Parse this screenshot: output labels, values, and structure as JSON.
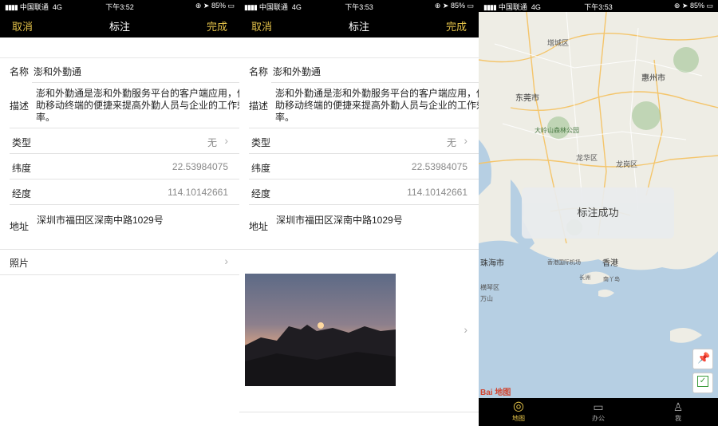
{
  "panels": [
    {
      "status": {
        "carrier": "中国联通",
        "network": "4G",
        "time": "下午3:52",
        "battery": "85%"
      },
      "nav": {
        "cancel": "取消",
        "title": "标注",
        "done": "完成"
      },
      "form": {
        "name_label": "名称",
        "name_value": "澎和外勤通",
        "desc_label": "描述",
        "desc_lines": [
          "澎和外勤通是澎和外勤服务平台的客户端应用，借",
          "助移动终端的便捷来提高外勤人员与企业的工作效",
          "率。"
        ],
        "type_label": "类型",
        "type_value": "无",
        "lat_label": "纬度",
        "lat_value": "22.53984075",
        "lng_label": "经度",
        "lng_value": "114.10142661",
        "addr_label": "地址",
        "addr_value": "深圳市福田区深南中路1029号",
        "photo_label": "照片"
      }
    },
    {
      "status": {
        "carrier": "中国联通",
        "network": "4G",
        "time": "下午3:53",
        "battery": "85%"
      },
      "nav": {
        "cancel": "取消",
        "title": "标注",
        "done": "完成"
      },
      "form": {
        "name_label": "名称",
        "name_value": "澎和外勤通",
        "desc_label": "描述",
        "desc_lines": [
          "澎和外勤通是澎和外勤服务平台的客户端应用，借",
          "助移动终端的便捷来提高外勤人员与企业的工作效",
          "率。"
        ],
        "type_label": "类型",
        "type_value": "无",
        "lat_label": "纬度",
        "lat_value": "22.53984075",
        "lng_label": "经度",
        "lng_value": "114.10142661",
        "addr_label": "地址",
        "addr_value": "深圳市福田区深南中路1029号"
      }
    },
    {
      "status": {
        "carrier": "中国联通",
        "network": "4G",
        "time": "下午3:53",
        "battery": "85%"
      },
      "map_labels": [
        "增城区",
        "惠州市",
        "东莞市",
        "大岭山森林公园",
        "龙华区",
        "龙岗区",
        "珠海市",
        "香港国际机场",
        "香港",
        "长洲",
        "南丫岛",
        "横琴区",
        "万山"
      ],
      "toast": "标注成功",
      "map_logo": "Bai 地图",
      "tabs": [
        "地图",
        "办公",
        "我"
      ]
    }
  ],
  "colors": {
    "accent": "#e6c44a",
    "nav_bg": "#000000"
  }
}
